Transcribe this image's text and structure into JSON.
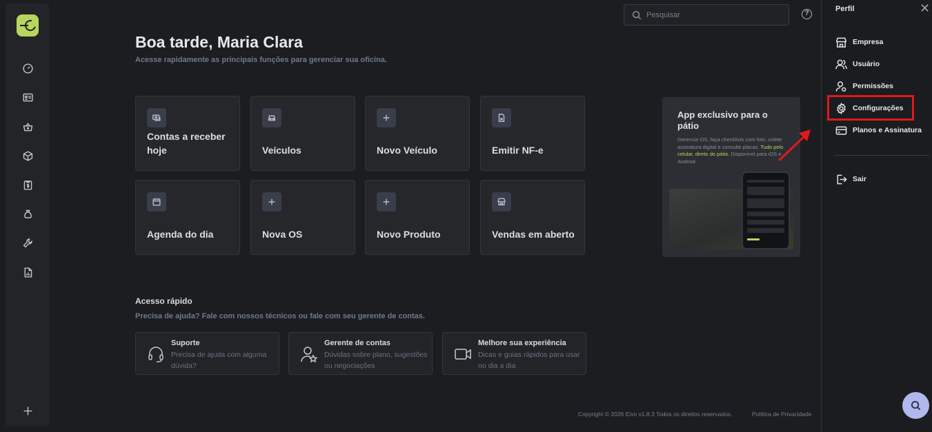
{
  "header": {
    "search_placeholder": "Pesquisar",
    "help_label": "?"
  },
  "greeting": {
    "title": "Boa tarde, Maria Clara",
    "subtitle": "Acesse rapidamente as principais funções para gerenciar sua oficina."
  },
  "shortcuts": [
    {
      "label": "Contas a receber hoje",
      "icon": "money-icon"
    },
    {
      "label": "Veículos",
      "icon": "car-icon"
    },
    {
      "label": "Novo Veículo",
      "icon": "plus-icon"
    },
    {
      "label": "Emitir NF-e",
      "icon": "document-icon"
    },
    {
      "label": "Agenda do dia",
      "icon": "calendar-icon"
    },
    {
      "label": "Nova OS",
      "icon": "plus-icon"
    },
    {
      "label": "Novo Produto",
      "icon": "plus-icon"
    },
    {
      "label": "Vendas em aberto",
      "icon": "store-icon"
    }
  ],
  "promo": {
    "title": "App exclusivo para o pátio",
    "desc_prefix": "Gerencie OS, faça checklists com foto, colete assinatura digital e consulte placas. ",
    "desc_highlight": "Tudo pelo celular, direto do pátio.",
    "desc_suffix": " Disponível para iOS e Android."
  },
  "quick_access": {
    "title": "Acesso rápido",
    "subtitle": "Precisa de ajuda? Fale com nossos técnicos ou fale com seu gerente de contas.",
    "items": [
      {
        "title": "Suporte",
        "desc": "Precisa de ajuda com alguma dúvida?",
        "icon": "headset-icon"
      },
      {
        "title": "Gerente de contas",
        "desc": "Dúvidas sobre plano, sugestões ou negociações",
        "icon": "user-star-icon"
      },
      {
        "title": "Melhore sua experiência",
        "desc": "Dicas e guias rápidos para usar no dia a dia",
        "icon": "video-icon"
      }
    ]
  },
  "footer": {
    "copyright": "Copyright © 2026 Eixo v1.8.3 Todos os direitos reservados.",
    "privacy": "Política de Privacidade"
  },
  "panel": {
    "title": "Perfil",
    "close": "✕",
    "items": [
      {
        "label": "Empresa",
        "icon": "store-icon"
      },
      {
        "label": "Usuário",
        "icon": "users-icon"
      },
      {
        "label": "Permissões",
        "icon": "user-lock-icon"
      },
      {
        "label": "Configurações",
        "icon": "gear-icon"
      },
      {
        "label": "Planos e Assinatura",
        "icon": "card-icon"
      }
    ],
    "logout": "Sair"
  },
  "colors": {
    "accent": "#b7d65c",
    "highlight_box": "#e0191d",
    "fab": "#b0b8ee"
  }
}
